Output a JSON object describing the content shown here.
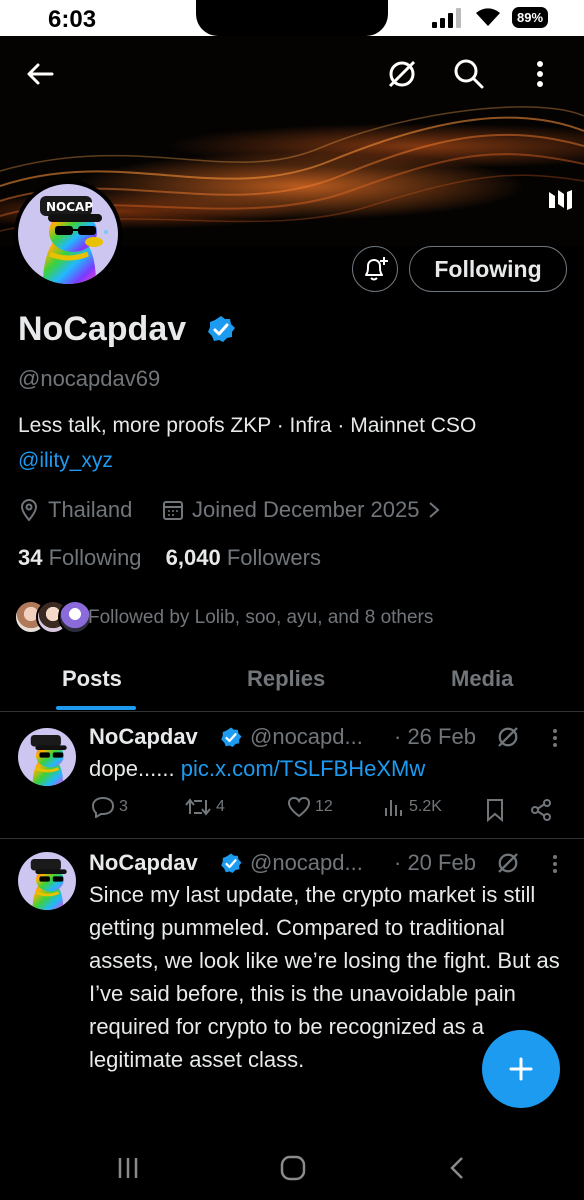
{
  "status_bar": {
    "time": "6:03",
    "battery": "89%"
  },
  "profile": {
    "avatar_cap_text": "NOCAP",
    "name": "NoCapdav",
    "handle": "@nocapdav69",
    "bio": "Less talk, more proofs ZKP · Infra · Mainnet  CSO",
    "bio_link": "@ility_xyz",
    "location": "Thailand",
    "joined": "Joined December 2025",
    "following_count": "34",
    "following_label": "Following",
    "followers_count": "6,040",
    "followers_label": "Followers",
    "followed_by": "Followed by Lolib, soo, ayu, and 8 others",
    "follow_button": "Following"
  },
  "tabs": [
    {
      "label": "Posts",
      "active": true
    },
    {
      "label": "Replies",
      "active": false
    },
    {
      "label": "Media",
      "active": false
    }
  ],
  "posts": [
    {
      "author": "NoCapdav",
      "handle": "@nocapd...",
      "date": "· 26 Feb",
      "text": "dope......",
      "link": "pic.x.com/TSLFBHeXMw",
      "replies": "3",
      "reposts": "4",
      "likes": "12",
      "views": "5.2K"
    },
    {
      "author": "NoCapdav",
      "handle": "@nocapd...",
      "date": "· 20 Feb",
      "text": "Since my last update, the crypto market is still getting pummeled. Compared to traditional assets, we look like we’re losing the fight. But as I’ve said before, this is the unavoidable pain required for crypto to be recognized as a legitimate asset class."
    }
  ],
  "colors": {
    "accent": "#1d9bf0",
    "muted": "#71767b",
    "text": "#e7e9ea",
    "background": "#000000"
  }
}
